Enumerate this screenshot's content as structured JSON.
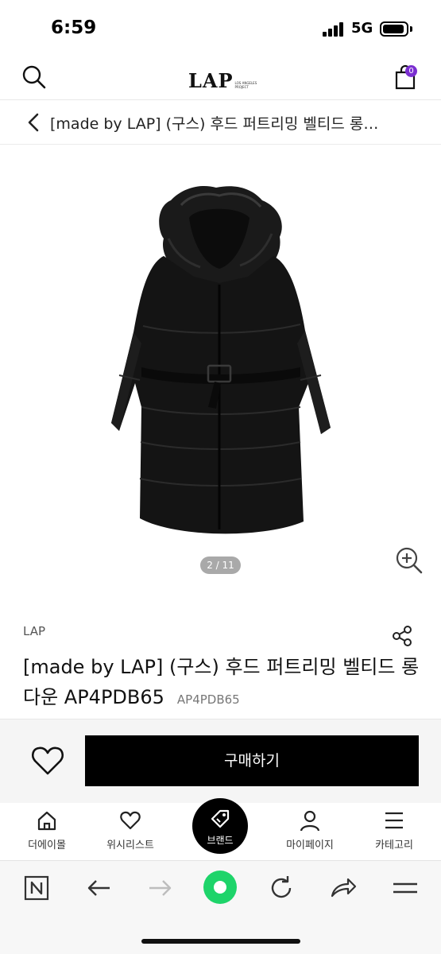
{
  "status_bar": {
    "time": "6:59",
    "network": "5G"
  },
  "header": {
    "logo": "LAP",
    "logo_sub": "LOS ANGELES PROJECT",
    "cart_count": "0",
    "accent_color": "#7b2fd1"
  },
  "breadcrumb": {
    "title": "[made by LAP] (구스) 후드 퍼트리밍 벨티드 롱…"
  },
  "gallery": {
    "page_indicator": "2 / 11",
    "current": 2,
    "total": 11
  },
  "product": {
    "brand": "LAP",
    "name": "[made by LAP] (구스) 후드 퍼트리밍 벨티드 롱다운 AP4PDB65",
    "code": "AP4PDB65"
  },
  "purchase": {
    "buy_label": "구매하기"
  },
  "bottom_nav": {
    "items": [
      {
        "label": "더에이몰",
        "icon": "home-icon"
      },
      {
        "label": "위시리스트",
        "icon": "heart-icon"
      },
      {
        "label": "브랜드",
        "icon": "tag-icon"
      },
      {
        "label": "마이페이지",
        "icon": "person-icon"
      },
      {
        "label": "카테고리",
        "icon": "menu-icon"
      }
    ]
  },
  "browser_toolbar": {
    "icons": [
      "naver-n-icon",
      "back-arrow-icon",
      "forward-arrow-icon",
      "green-home-icon",
      "refresh-icon",
      "share-arrow-icon",
      "menu-icon"
    ],
    "accent_color": "#1ed46a"
  }
}
